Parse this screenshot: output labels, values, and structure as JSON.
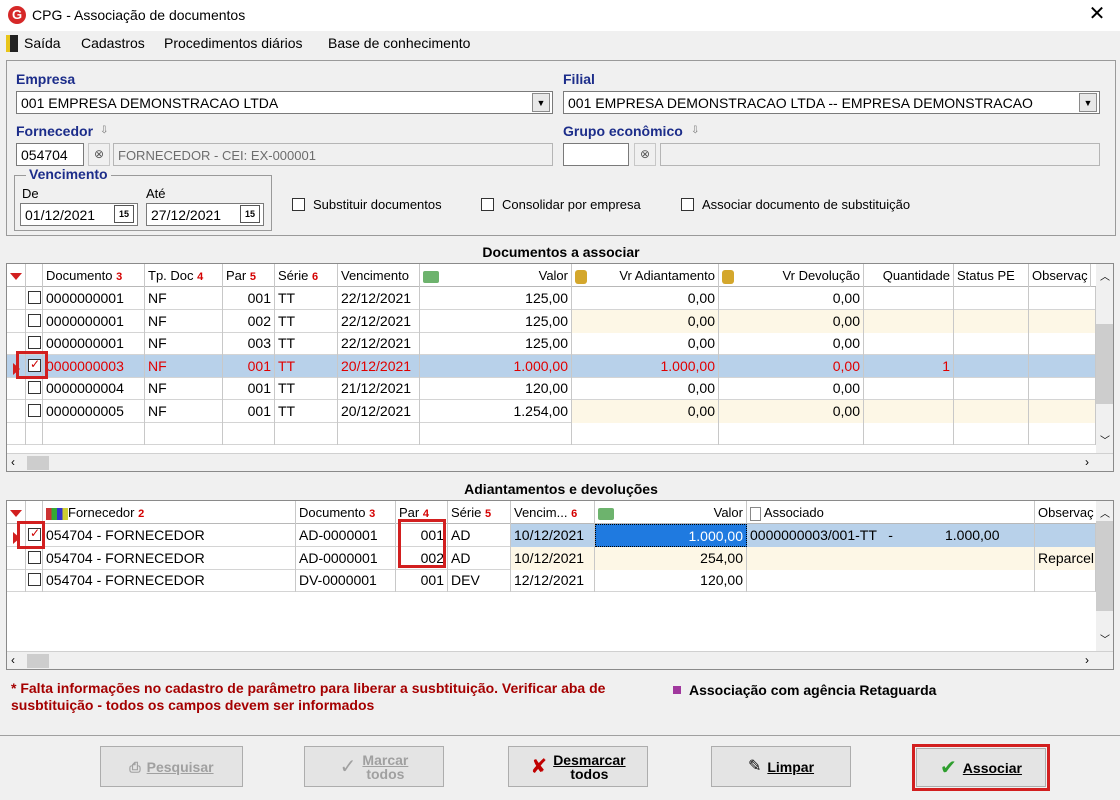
{
  "window": {
    "title": "CPG - Associação de documentos",
    "close": "✕"
  },
  "menu": [
    "Saída",
    "Cadastros",
    "Procedimentos diários",
    "Base de conhecimento"
  ],
  "filters": {
    "empresa_label": "Empresa",
    "empresa_value": "001 EMPRESA DEMONSTRACAO LTDA",
    "filial_label": "Filial",
    "filial_value": "001 EMPRESA DEMONSTRACAO LTDA -- EMPRESA DEMONSTRACAO",
    "fornecedor_label": "Fornecedor",
    "fornecedor_code": "054704",
    "fornecedor_name": "FORNECEDOR - CEI: EX-000001",
    "grupo_label": "Grupo econômico",
    "grupo_code": "",
    "vencimento_label": "Vencimento",
    "de_label": "De",
    "de_value": "01/12/2021",
    "ate_label": "Até",
    "ate_value": "27/12/2021",
    "cal_icon": "15",
    "chk_substituir": "Substituir documentos",
    "chk_consolidar": "Consolidar por empresa",
    "chk_associar_sub": "Associar documento de substituição"
  },
  "docs": {
    "title": "Documentos a associar",
    "headers": {
      "documento": "Documento",
      "documento_n": "3",
      "tpdoc": "Tp. Doc",
      "tpdoc_n": "4",
      "par": "Par",
      "par_n": "5",
      "serie": "Série",
      "serie_n": "6",
      "vencimento": "Vencimento",
      "valor": "Valor",
      "vradiant": "Vr Adiantamento",
      "vrdevol": "Vr Devolução",
      "quantidade": "Quantidade",
      "status": "Status PE",
      "obs": "Observaç"
    },
    "rows": [
      {
        "doc": "0000000001",
        "tp": "NF",
        "par": "001",
        "serie": "TT",
        "venc": "22/12/2021",
        "valor": "125,00",
        "adiant": "0,00",
        "devol": "0,00",
        "qtd": ""
      },
      {
        "doc": "0000000001",
        "tp": "NF",
        "par": "002",
        "serie": "TT",
        "venc": "22/12/2021",
        "valor": "125,00",
        "adiant": "0,00",
        "devol": "0,00",
        "qtd": ""
      },
      {
        "doc": "0000000001",
        "tp": "NF",
        "par": "003",
        "serie": "TT",
        "venc": "22/12/2021",
        "valor": "125,00",
        "adiant": "0,00",
        "devol": "0,00",
        "qtd": ""
      },
      {
        "doc": "0000000003",
        "tp": "NF",
        "par": "001",
        "serie": "TT",
        "venc": "20/12/2021",
        "valor": "1.000,00",
        "adiant": "1.000,00",
        "devol": "0,00",
        "qtd": "1"
      },
      {
        "doc": "0000000004",
        "tp": "NF",
        "par": "001",
        "serie": "TT",
        "venc": "21/12/2021",
        "valor": "120,00",
        "adiant": "0,00",
        "devol": "0,00",
        "qtd": ""
      },
      {
        "doc": "0000000005",
        "tp": "NF",
        "par": "001",
        "serie": "TT",
        "venc": "20/12/2021",
        "valor": "1.254,00",
        "adiant": "0,00",
        "devol": "0,00",
        "qtd": ""
      }
    ]
  },
  "adiant": {
    "title": "Adiantamentos e devoluções",
    "headers": {
      "fornecedor": "Fornecedor",
      "fornecedor_n": "2",
      "documento": "Documento",
      "documento_n": "3",
      "par": "Par",
      "par_n": "4",
      "serie": "Série",
      "serie_n": "5",
      "venc": "Vencim...",
      "venc_n": "6",
      "valor": "Valor",
      "associado": "Associado",
      "obs": "Observaç"
    },
    "rows": [
      {
        "forn": "054704 - FORNECEDOR",
        "doc": "AD-0000001",
        "par": "001",
        "serie": "AD",
        "venc": "10/12/2021",
        "valor": "1.000,00",
        "assoc": "0000000003/001-TT   -",
        "assoc_val": "1.000,00",
        "obs": ""
      },
      {
        "forn": "054704 - FORNECEDOR",
        "doc": "AD-0000001",
        "par": "002",
        "serie": "AD",
        "venc": "10/12/2021",
        "valor": "254,00",
        "assoc": "",
        "assoc_val": "",
        "obs": "Reparcel"
      },
      {
        "forn": "054704 - FORNECEDOR",
        "doc": "DV-0000001",
        "par": "001",
        "serie": "DEV",
        "venc": "12/12/2021",
        "valor": "120,00",
        "assoc": "",
        "assoc_val": "",
        "obs": ""
      }
    ]
  },
  "notes": {
    "warning": "* Falta informações no cadastro de parâmetro para liberar a susbtituição. Verificar aba de susbtituição - todos os campos devem ser informados",
    "legend": "Associação com agência Retaguarda"
  },
  "buttons": {
    "pesquisar": "Pesquisar",
    "marcar_1": "Marcar",
    "marcar_2": "todos",
    "desmarcar_1": "Desmarcar",
    "desmarcar_2": "todos",
    "limpar": "Limpar",
    "associar": "Associar"
  }
}
